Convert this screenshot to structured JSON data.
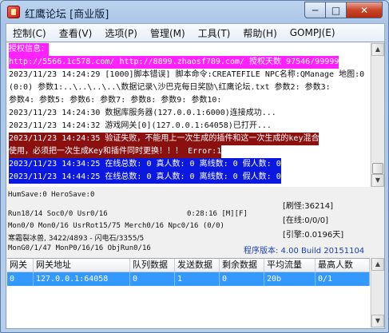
{
  "window": {
    "title": "红鹰论坛 [商业版]"
  },
  "title_buttons": {
    "minimize": "─",
    "maximize": "□",
    "close": "✕"
  },
  "menu": [
    "控制(C)",
    "查看(V)",
    "选项(P)",
    "管理(M)",
    "工具(T)",
    "帮助(H)",
    "GOMPJ(E)"
  ],
  "log": [
    {
      "text": "授权信息：",
      "bg": "#ff22ff",
      "fg": "#ffffff"
    },
    {
      "text": "http://5566.1c578.com/ http://8899.zhaosf789.com/ 授权天数 97546/99999",
      "bg": "#ff22ff",
      "fg": "#ffffff"
    },
    {
      "text": "2023/11/23 14:24:29 [1000]脚本错误] 脚本命令:CREATEFILE NPC名称:QManage 地图:0",
      "bg": "",
      "fg": "#111111"
    },
    {
      "text": "(0:0) 参数1:..\\..\\..\\..\\数据记录\\沙巴克每日奖励\\红鹰论坛.txt 参数2: 参数3:",
      "bg": "",
      "fg": "#111111"
    },
    {
      "text": "参数4: 参数5: 参数6: 参数7: 参数8: 参数9: 参数10:",
      "bg": "",
      "fg": "#111111"
    },
    {
      "text": "2023/11/23 14:24:30 数据库服务器(127.0.0.1:6000)连接成功...",
      "bg": "",
      "fg": "#111111"
    },
    {
      "text": "2023/11/23 14:24:32 游戏网关[0](127.0.0.1:64058)已打开...",
      "bg": "",
      "fg": "#111111"
    },
    {
      "text": "2023/11/23 14:24:35 验证失败，不能用上一次生成的插件和这一次生成的key混合",
      "bg": "#8b1010",
      "fg": "#ffffff"
    },
    {
      "text": "使用，必须把一次生成Key和插件同时更换！！！ Error:1",
      "bg": "#8b1010",
      "fg": "#ffffff"
    },
    {
      "text": "2023/11/23 14:34:25 在线总数: 0 真人数: 0 离线数: 0 假人数: 0",
      "bg": "#0a18e0",
      "fg": "#ffffff"
    },
    {
      "text": "2023/11/23 14:44:25 在线总数: 0 真人数: 0 离线数: 0 假人数: 0",
      "bg": "#0a18e0",
      "fg": "#ffffff"
    }
  ],
  "status": {
    "humsave": "HumSave:0 HeroSave:0",
    "run": "Run18/14 Soc0/0 Usr0/16",
    "time": "0:28:16 [M][F]",
    "mon": "Mon0/0 Mon0/16 UsrRot15/75 Merch0/16 Npc0/16 (0/0)",
    "boss": "寒霜裂冰兽, 3422/4893 - 闪电石/3355/5",
    "mongen": "MonG0/1/47 MonP0/16/16 ObjRun0/16",
    "refresh": "[刷怪:36214]",
    "online": "[在线:0/0/0]",
    "engine": "[引擎:0.0196天]",
    "version": "程序版本: 4.00 Build 20151104"
  },
  "table": {
    "headers": [
      "网关",
      "网关地址",
      "队列数据",
      "发送数据",
      "剩余数据",
      "平均流量",
      "最高人数"
    ],
    "rows": [
      [
        "0",
        "127.0.0.1:64058",
        "0",
        "1",
        "0",
        "20b",
        "0/1"
      ]
    ]
  }
}
